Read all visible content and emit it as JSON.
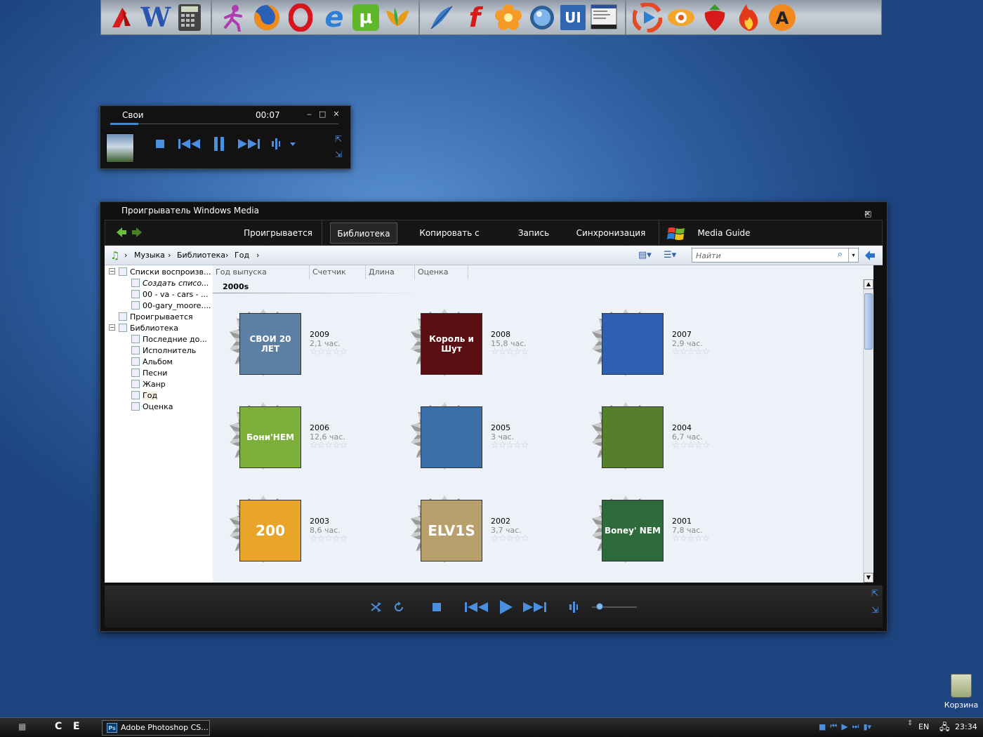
{
  "dock": {
    "groups": [
      {
        "icons": [
          "acrobat-icon",
          "word-icon",
          "calculator-icon"
        ]
      },
      {
        "icons": [
          "icq-icon",
          "firefox-icon",
          "opera-icon",
          "internet-explorer-icon",
          "utorrent-icon",
          "miranda-icon"
        ]
      },
      {
        "icons": [
          "feather-icon",
          "flash-icon",
          "flower-icon",
          "orb-icon",
          "ui-designer-icon",
          "taskmgr-icon"
        ]
      },
      {
        "icons": [
          "media-player-icon",
          "eye-icon",
          "strawberry-icon",
          "flame-icon",
          "aimp-icon"
        ]
      }
    ]
  },
  "mini_player": {
    "title": "Свои",
    "time": "00:07"
  },
  "wmp": {
    "title": "Проигрыватель Windows Media",
    "tabs": [
      "Проигрывается",
      "Библиотека",
      "Копировать с диска",
      "Запись",
      "Синхронизация",
      "Media Guide"
    ],
    "active_tab": "Библиотека",
    "breadcrumb": [
      "Музыка",
      "Библиотека",
      "Год"
    ],
    "search_placeholder": "Найти",
    "tree": [
      {
        "label": "Списки воспроизв...",
        "level": 0,
        "expander": "−"
      },
      {
        "label": "Создать списо...",
        "level": 1,
        "italic": true
      },
      {
        "label": "00 - va - cars - ...",
        "level": 1
      },
      {
        "label": "00-gary_moore....",
        "level": 1
      },
      {
        "label": "Проигрывается",
        "level": 0
      },
      {
        "label": "Библиотека",
        "level": 0,
        "expander": "−"
      },
      {
        "label": "Последние до...",
        "level": 1
      },
      {
        "label": "Исполнитель",
        "level": 1
      },
      {
        "label": "Альбом",
        "level": 1
      },
      {
        "label": "Песни",
        "level": 1
      },
      {
        "label": "Жанр",
        "level": 1
      },
      {
        "label": "Год",
        "level": 1,
        "selected": true
      },
      {
        "label": "Оценка",
        "level": 1
      }
    ],
    "columns": [
      "Год выпуска",
      "Счетчик",
      "Длина",
      "Оценка"
    ],
    "group_header": "2000s",
    "years": [
      {
        "year": "2009",
        "duration": "2,1 час.",
        "cover_text": "СВОИ 20 ЛЕТ",
        "cover_color": "#5d7fa3"
      },
      {
        "year": "2008",
        "duration": "15,8 час.",
        "cover_text": "Король и Шут",
        "cover_color": "#5a0e12"
      },
      {
        "year": "2007",
        "duration": "2,9 час.",
        "cover_text": "",
        "cover_color": "#2f5fb0"
      },
      {
        "year": "2006",
        "duration": "12,6 час.",
        "cover_text": "Бони'НЕМ",
        "cover_color": "#7cae3a"
      },
      {
        "year": "2005",
        "duration": "3 час.",
        "cover_text": "",
        "cover_color": "#3a6fa8"
      },
      {
        "year": "2004",
        "duration": "6,7 час.",
        "cover_text": "",
        "cover_color": "#567f2c"
      },
      {
        "year": "2003",
        "duration": "8,6 час.",
        "cover_text": "200",
        "cover_color": "#e8a52a"
      },
      {
        "year": "2002",
        "duration": "3,7 час.",
        "cover_text": "ELV1S",
        "cover_color": "#b7a06c"
      },
      {
        "year": "2001",
        "duration": "7,8 час.",
        "cover_text": "Boney' NEM",
        "cover_color": "#2e6b3c"
      }
    ],
    "rating_stars": "☆☆☆☆☆"
  },
  "taskbar": {
    "task": "Adobe Photoshop CS...",
    "task_icon": "Ps",
    "language": "EN",
    "clock": "23:34",
    "quick_launch": [
      "C",
      "E"
    ]
  },
  "desktop": {
    "recycle_bin": "Корзина"
  },
  "colors": {
    "accent": "#3f86d8",
    "player_bg": "#121212",
    "library_bg": "#edf2f9"
  }
}
